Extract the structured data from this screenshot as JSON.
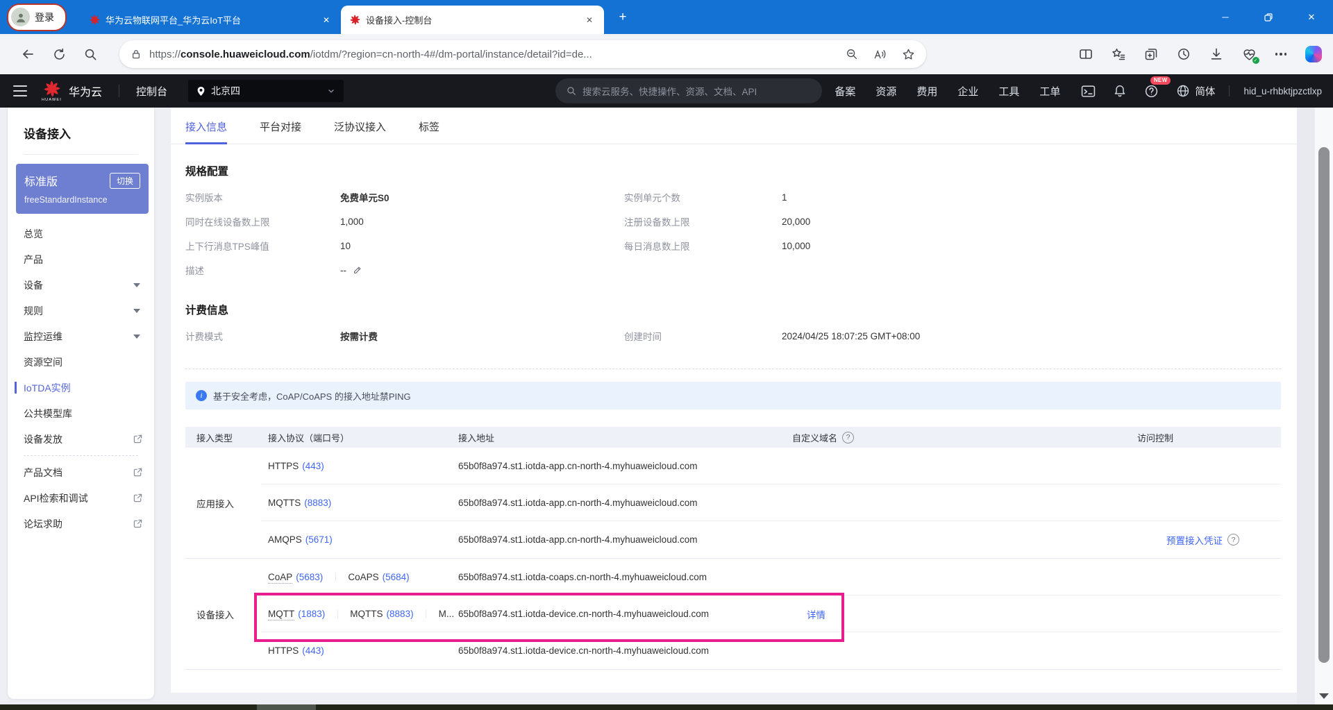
{
  "browser": {
    "profile": {
      "label": "登录"
    },
    "tabs": [
      {
        "title": "华为云物联网平台_华为云IoT平台",
        "active": false
      },
      {
        "title": "设备接入-控制台",
        "active": true
      }
    ],
    "address": {
      "scheme": "https://",
      "host": "console.huaweicloud.com",
      "path": "/iotdm/?region=cn-north-4#/dm-portal/instance/detail?id=de..."
    }
  },
  "glyphs": {
    "close": "✕",
    "plus": "+",
    "minimize": "─",
    "pipe": "｜"
  },
  "nav": {
    "brand": "华为云",
    "brand_sub": "HUAWEI",
    "console_label": "控制台",
    "region": "北京四",
    "search_placeholder": "搜索云服务、快捷操作、资源、文档、API",
    "menu": [
      "备案",
      "资源",
      "费用",
      "企业",
      "工具",
      "工单"
    ],
    "new_badge": "NEW",
    "lang": "简体",
    "user_id": "hid_u-rhbktjpzctlxp"
  },
  "sidebar": {
    "title": "设备接入",
    "instance": {
      "edition": "标准版",
      "switch_label": "切换",
      "name": "freeStandardInstance"
    },
    "items": [
      {
        "label": "总览"
      },
      {
        "label": "产品"
      },
      {
        "label": "设备",
        "arrow": true
      },
      {
        "label": "规则",
        "arrow": true
      },
      {
        "label": "监控运维",
        "arrow": true
      },
      {
        "label": "资源空间"
      },
      {
        "label": "IoTDA实例",
        "active": true
      },
      {
        "label": "公共模型库"
      },
      {
        "label": "设备发放",
        "external": true,
        "divider_after": true
      },
      {
        "label": "产品文档",
        "external": true
      },
      {
        "label": "API检索和调试",
        "external": true
      },
      {
        "label": "论坛求助",
        "external": true
      }
    ]
  },
  "main": {
    "tabs": [
      {
        "label": "接入信息",
        "active": true
      },
      {
        "label": "平台对接"
      },
      {
        "label": "泛协议接入"
      },
      {
        "label": "标签"
      }
    ],
    "spec": {
      "title": "规格配置",
      "fields": [
        {
          "label": "实例版本",
          "value": "免费单元S0",
          "bold": true
        },
        {
          "label": "实例单元个数",
          "value": "1"
        },
        {
          "label": "同时在线设备数上限",
          "value": "1,000"
        },
        {
          "label": "注册设备数上限",
          "value": "20,000"
        },
        {
          "label": "上下行消息TPS峰值",
          "value": "10"
        },
        {
          "label": "每日消息数上限",
          "value": "10,000"
        },
        {
          "label": "描述",
          "value": "--",
          "editable": true
        }
      ]
    },
    "billing": {
      "title": "计费信息",
      "fields": [
        {
          "label": "计费模式",
          "value": "按需计费",
          "bold": true
        },
        {
          "label": "创建时间",
          "value": "2024/04/25 18:07:25 GMT+08:00"
        }
      ]
    },
    "banner": "基于安全考虑，CoAP/CoAPS 的接入地址禁PING",
    "table": {
      "headers": [
        "接入类型",
        "接入协议（端口号）",
        "接入地址",
        "自定义域名",
        "访问控制"
      ],
      "groups": [
        {
          "type": "应用接入",
          "rows": [
            {
              "protocols": [
                {
                  "name": "HTTPS",
                  "port": "443"
                }
              ],
              "address": "65b0f8a974.st1.iotda-app.cn-north-4.myhuaweicloud.com"
            },
            {
              "protocols": [
                {
                  "name": "MQTTS",
                  "port": "8883"
                }
              ],
              "address": "65b0f8a974.st1.iotda-app.cn-north-4.myhuaweicloud.com"
            },
            {
              "protocols": [
                {
                  "name": "AMQPS",
                  "port": "5671"
                }
              ],
              "address": "65b0f8a974.st1.iotda-app.cn-north-4.myhuaweicloud.com",
              "access": "预置接入凭证"
            }
          ]
        },
        {
          "type": "设备接入",
          "rows": [
            {
              "protocols": [
                {
                  "name": "CoAP",
                  "port": "5683",
                  "dotted": true
                },
                {
                  "name": "CoAPS",
                  "port": "5684"
                }
              ],
              "address": "65b0f8a974.st1.iotda-coaps.cn-north-4.myhuaweicloud.com"
            },
            {
              "protocols": [
                {
                  "name": "MQTT",
                  "port": "1883",
                  "dotted": true
                },
                {
                  "name": "MQTTS",
                  "port": "8883"
                },
                {
                  "name": "M...",
                  "port": ""
                }
              ],
              "address": "65b0f8a974.st1.iotda-device.cn-north-4.myhuaweicloud.com",
              "detail": "详情",
              "highlighted": true
            },
            {
              "protocols": [
                {
                  "name": "HTTPS",
                  "port": "443"
                }
              ],
              "address": "65b0f8a974.st1.iotda-device.cn-north-4.myhuaweicloud.com"
            }
          ]
        }
      ]
    }
  },
  "colors": {
    "edge_blue": "#1472d4",
    "nav_bg": "#17191f",
    "accent_blue": "#5061dd",
    "link_blue": "#3f66f0",
    "instance_card_blue": "#6e7fd2",
    "highlight_pink": "#ea1d8e",
    "banner_bg": "#e9f2fd",
    "table_header_bg": "#eef1f8"
  }
}
